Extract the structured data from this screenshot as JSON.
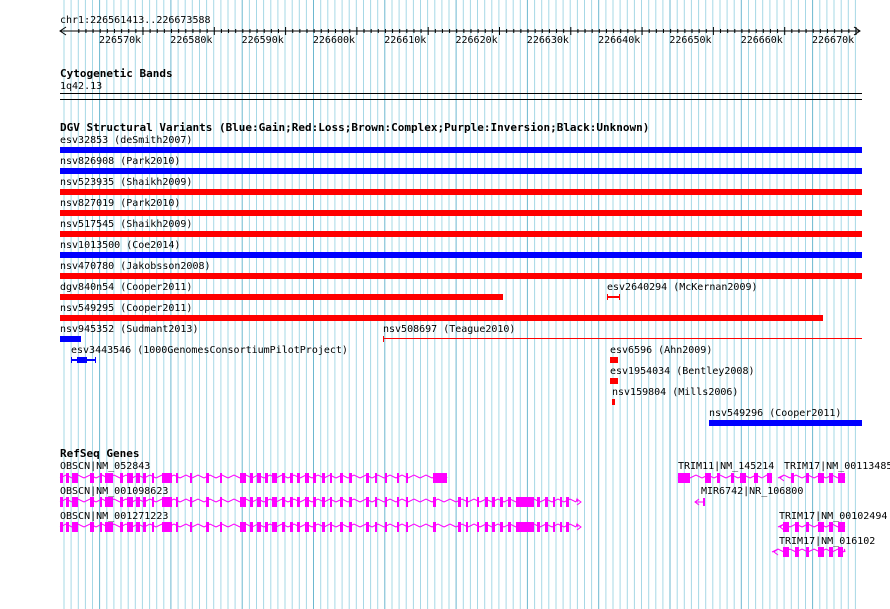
{
  "ruler": {
    "region": "chr1:226561413..226673588",
    "ticks": [
      "226570k",
      "226580k",
      "226590k",
      "226600k",
      "226610k",
      "226620k",
      "226630k",
      "226640k",
      "226650k",
      "226660k",
      "226670k"
    ]
  },
  "cytoband": {
    "title": "Cytogenetic Bands",
    "band": "1q42.13"
  },
  "dgv": {
    "title": "DGV Structural Variants (Blue:Gain;Red:Loss;Brown:Complex;Purple:Inversion;Black:Unknown)",
    "variants": [
      {
        "label": "esv32853 (deSmith2007)",
        "type": "gain"
      },
      {
        "label": "nsv826908 (Park2010)",
        "type": "gain"
      },
      {
        "label": "nsv523935 (Shaikh2009)",
        "type": "loss"
      },
      {
        "label": "nsv827019 (Park2010)",
        "type": "loss"
      },
      {
        "label": "nsv517545 (Shaikh2009)",
        "type": "loss"
      },
      {
        "label": "nsv1013500 (Coe2014)",
        "type": "gain"
      },
      {
        "label": "nsv470780 (Jakobsson2008)",
        "type": "loss"
      },
      {
        "label": "dgv840n54 (Cooper2011)",
        "type": "loss"
      },
      {
        "label": "esv2640294 (McKernan2009)",
        "type": "loss"
      },
      {
        "label": "nsv549295 (Cooper2011)",
        "type": "loss"
      },
      {
        "label": "nsv945352 (Sudmant2013)",
        "type": "gain"
      },
      {
        "label": "nsv508697 (Teague2010)",
        "type": "loss"
      },
      {
        "label": "esv3443546 (1000GenomesConsortiumPilotProject)",
        "type": "gain"
      },
      {
        "label": "esv6596 (Ahn2009)",
        "type": "loss"
      },
      {
        "label": "esv1954034 (Bentley2008)",
        "type": "loss"
      },
      {
        "label": "nsv159804 (Mills2006)",
        "type": "loss"
      },
      {
        "label": "nsv549296 (Cooper2011)",
        "type": "gain"
      }
    ]
  },
  "refseq": {
    "title": "RefSeq Genes",
    "genes": [
      {
        "label": "OBSCN|NM_052843"
      },
      {
        "label": "OBSCN|NM_001098623"
      },
      {
        "label": "OBSCN|NM_001271223"
      },
      {
        "label": "TRIM11|NM_145214"
      },
      {
        "label": "TRIM17|NM_00113485"
      },
      {
        "label": "MIR6742|NR_106800"
      },
      {
        "label": "TRIM17|NM_00102494"
      },
      {
        "label": "TRIM17|NM_016102"
      }
    ]
  },
  "colors": {
    "gain": "#0000ff",
    "loss": "#ff0000",
    "gene": "#ff00ff",
    "grid": "#a6d8e6"
  }
}
